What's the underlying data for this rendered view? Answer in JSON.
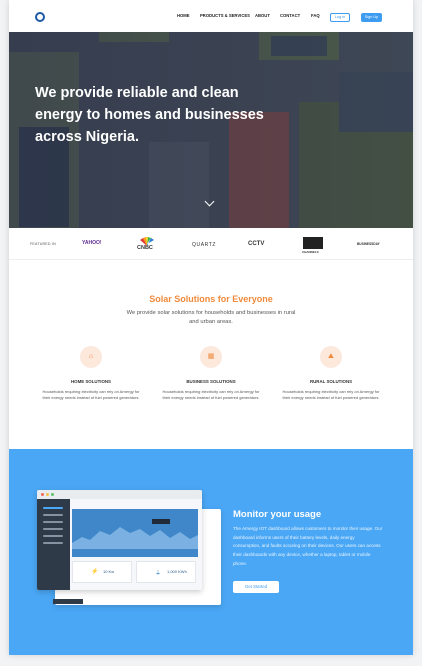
{
  "header": {
    "nav": [
      "HOME",
      "PRODUCTS & SERVICES",
      "ABOUT",
      "CONTACT",
      "FAQ"
    ],
    "login_label": "Log In",
    "signup_label": "Sign Up"
  },
  "hero": {
    "title": "We provide reliable and clean energy to homes and businesses across Nigeria."
  },
  "featured": {
    "label": "FEATURED IN",
    "logos": [
      "YAHOO!",
      "CNBC",
      "QUARTZ",
      "CCTV",
      "CHANNELS",
      "BUSINESSDAY"
    ]
  },
  "solutions": {
    "title": "Solar Solutions for Everyone",
    "subtitle": "We provide solar solutions for households and businesses in rural and urban areas.",
    "cards": [
      {
        "icon": "house-icon",
        "title": "HOME SOLUTIONS",
        "text": "Households requiring electricity can rely on Arnergy for their energy needs instead of fuel powered generators."
      },
      {
        "icon": "building-icon",
        "title": "BUSINESS SOLUTIONS",
        "text": "Households requiring electricity can rely on Arnergy for their energy needs instead of fuel powered generators."
      },
      {
        "icon": "landscape-icon",
        "title": "RURAL SOLUTIONS",
        "text": "Households requiring electricity can rely on Arnergy for their energy needs instead of fuel powered generators."
      }
    ]
  },
  "monitor": {
    "title": "Monitor your usage",
    "text": "The Arnergy IOT dashboard allows customers to monitor their usage. Our dashboard informs users of their battery levels, daily energy consumption, and faults occuring on their devices. Our users can access their dashboards with any device, whether a laptop, tablet or mobile phone.",
    "button_label": "Get Started",
    "dashboard": {
      "stat1": "10 Kw",
      "stat2": "1,000 KWh"
    }
  },
  "colors": {
    "accent_orange": "#f08a3c",
    "accent_blue": "#3d9bf0",
    "monitor_bg": "#4aa7f5"
  }
}
